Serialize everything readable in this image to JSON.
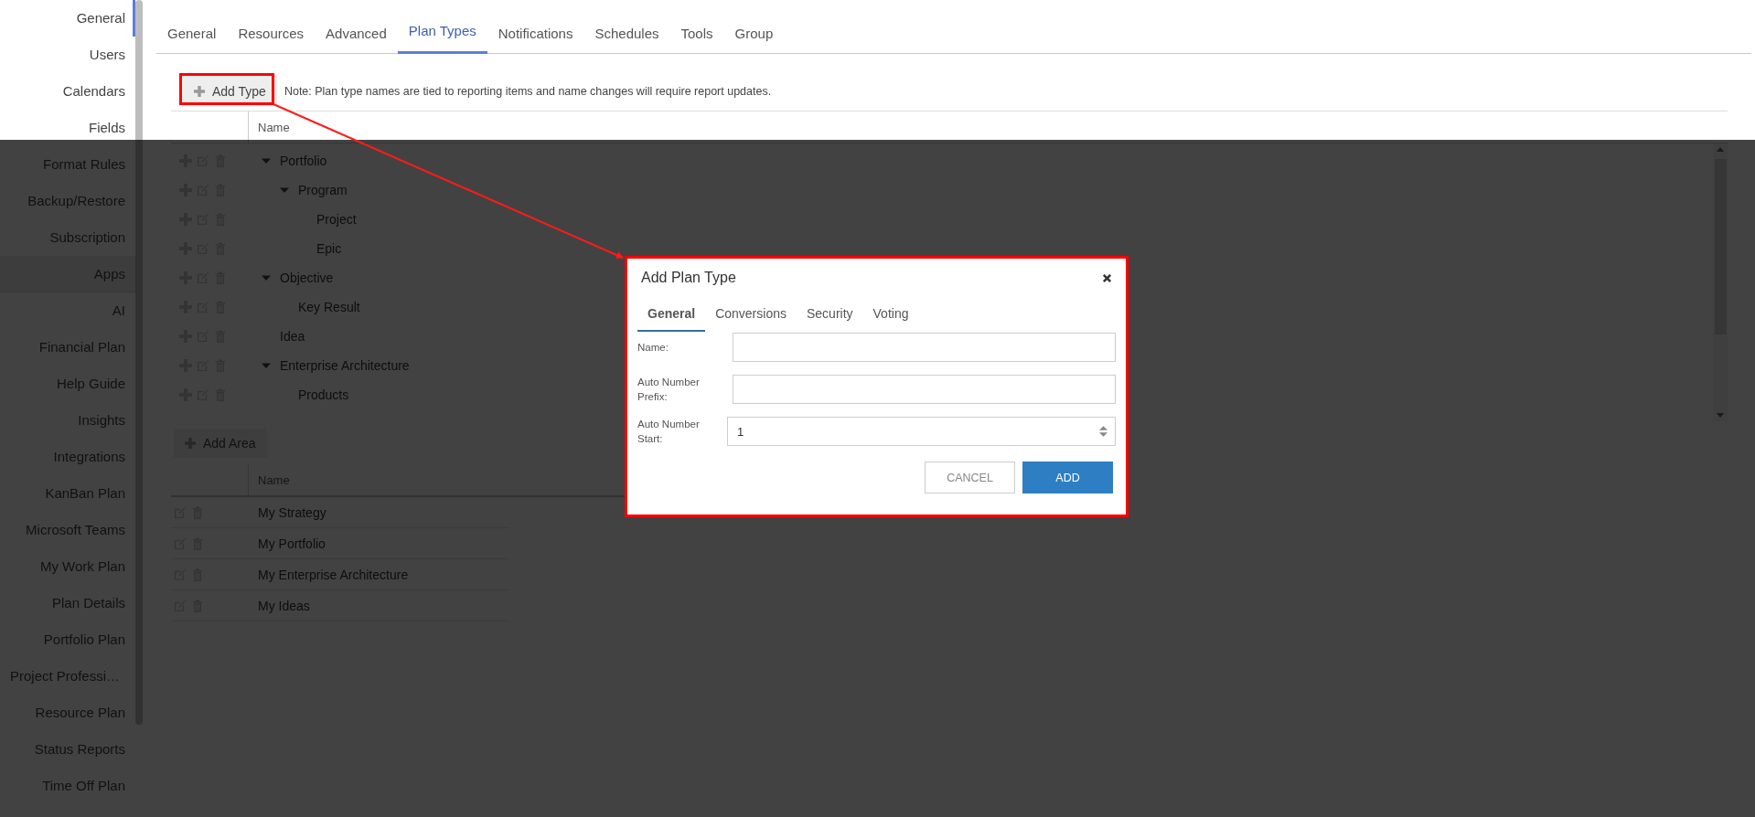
{
  "sidebar": {
    "items": [
      {
        "label": "General",
        "kind": "item",
        "selected": true
      },
      {
        "label": "Users",
        "kind": "item",
        "selected": false
      },
      {
        "label": "Calendars",
        "kind": "item",
        "selected": false
      },
      {
        "label": "Fields",
        "kind": "item",
        "selected": false
      },
      {
        "label": "Format Rules",
        "kind": "item",
        "selected": false
      },
      {
        "label": "Backup/Restore",
        "kind": "item",
        "selected": false
      },
      {
        "label": "Subscription",
        "kind": "item",
        "selected": false
      },
      {
        "label": "Apps",
        "kind": "header",
        "selected": false
      },
      {
        "label": "AI",
        "kind": "item",
        "selected": false
      },
      {
        "label": "Financial Plan",
        "kind": "item",
        "selected": false
      },
      {
        "label": "Help Guide",
        "kind": "item",
        "selected": false
      },
      {
        "label": "Insights",
        "kind": "item",
        "selected": false
      },
      {
        "label": "Integrations",
        "kind": "item",
        "selected": false
      },
      {
        "label": "KanBan Plan",
        "kind": "item",
        "selected": false
      },
      {
        "label": "Microsoft Teams",
        "kind": "item",
        "selected": false
      },
      {
        "label": "My Work Plan",
        "kind": "item",
        "selected": false
      },
      {
        "label": "Plan Details",
        "kind": "item",
        "selected": false
      },
      {
        "label": "Portfolio Plan",
        "kind": "item",
        "selected": false
      },
      {
        "label": "Project Professi…",
        "kind": "truncated",
        "selected": false
      },
      {
        "label": "Resource Plan",
        "kind": "item",
        "selected": false
      },
      {
        "label": "Status Reports",
        "kind": "item",
        "selected": false
      },
      {
        "label": "Time Off Plan",
        "kind": "item",
        "selected": false
      }
    ]
  },
  "tabs": [
    {
      "label": "General",
      "selected": false
    },
    {
      "label": "Resources",
      "selected": false
    },
    {
      "label": "Advanced",
      "selected": false
    },
    {
      "label": "Plan Types",
      "selected": true
    },
    {
      "label": "Notifications",
      "selected": false
    },
    {
      "label": "Schedules",
      "selected": false
    },
    {
      "label": "Tools",
      "selected": false
    },
    {
      "label": "Group",
      "selected": false
    }
  ],
  "toolbar": {
    "add_button": "Add Type",
    "highlighted": true,
    "note": "Note: Plan type names are tied to reporting items and name changes will require report updates."
  },
  "types_table": {
    "columns": [
      "Name"
    ],
    "rows": [
      {
        "name": "Portfolio",
        "expanded": true,
        "children": [
          {
            "name": "Program",
            "expanded": true,
            "children": [
              {
                "name": "Project"
              },
              {
                "name": "Epic"
              }
            ]
          }
        ]
      },
      {
        "name": "Objective",
        "expanded": true,
        "children": [
          {
            "name": "Key Result"
          }
        ]
      },
      {
        "name": "Idea"
      },
      {
        "name": "Enterprise Architecture",
        "expanded": true,
        "children": [
          {
            "name": "Products"
          }
        ]
      }
    ]
  },
  "areas": {
    "add_button": "Add Area",
    "columns": [
      "Name"
    ],
    "rows": [
      "My Strategy",
      "My Portfolio",
      "My Enterprise Architecture",
      "My Ideas"
    ]
  },
  "dialog": {
    "title": "Add Plan Type",
    "highlighted": true,
    "tabs": [
      {
        "label": "General",
        "selected": true
      },
      {
        "label": "Conversions",
        "selected": false
      },
      {
        "label": "Security",
        "selected": false
      },
      {
        "label": "Voting",
        "selected": false
      }
    ],
    "fields": [
      {
        "label": "Name:",
        "kind": "text"
      },
      {
        "label": "Auto Number Prefix:",
        "kind": "text"
      },
      {
        "label": "Auto Number Start:",
        "kind": "number",
        "value": "1"
      }
    ],
    "buttons": [
      {
        "label": "CANCEL",
        "kind": "secondary"
      },
      {
        "label": "ADD",
        "kind": "primary"
      }
    ]
  }
}
